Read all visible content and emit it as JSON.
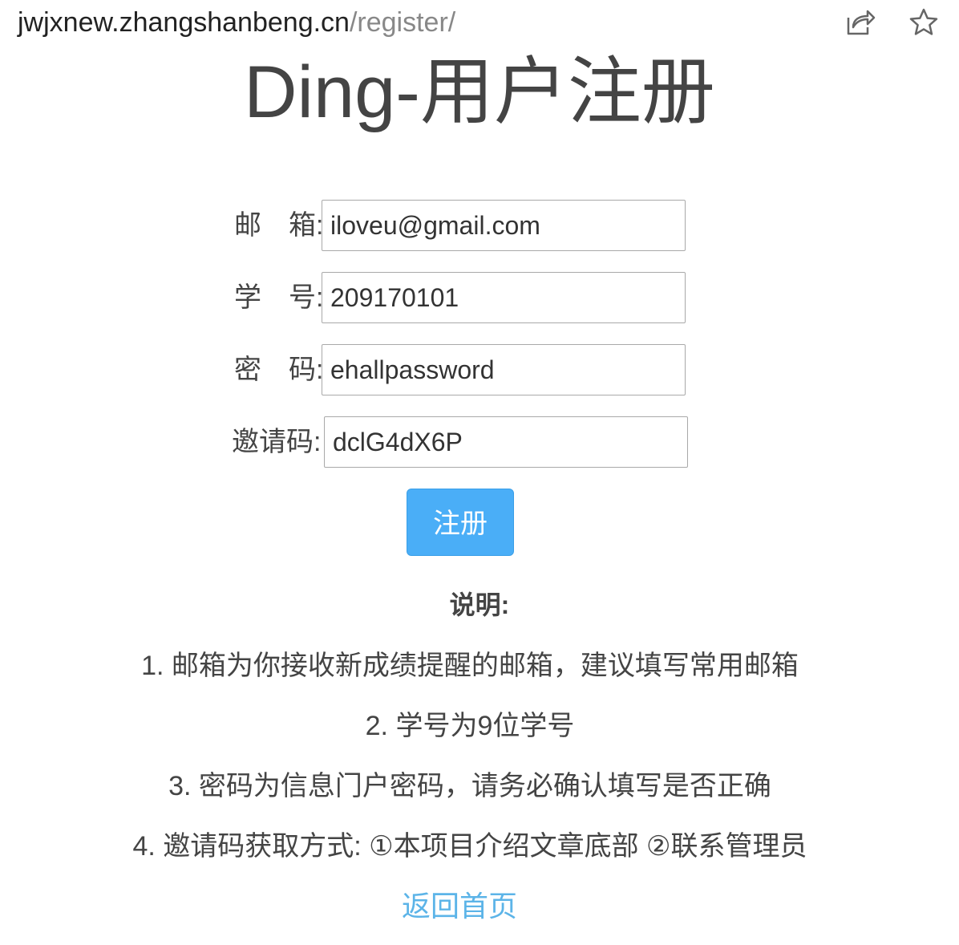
{
  "browser": {
    "url_host": "jwjxnew.zhangshanbeng.cn",
    "url_path": "/register/",
    "share_icon": "share-icon",
    "star_icon": "star-icon"
  },
  "page": {
    "title": "Ding-用户注册"
  },
  "form": {
    "email": {
      "label": "邮　箱:",
      "value": "iloveu@gmail.com"
    },
    "student_id": {
      "label": "学　号:",
      "value": "209170101"
    },
    "password": {
      "label": "密　码:",
      "value": "ehallpassword"
    },
    "invite_code": {
      "label": "邀请码:",
      "value": "dclG4dX6P"
    },
    "submit_label": "注册"
  },
  "instructions": {
    "title": "说明:",
    "items": [
      "1. 邮箱为你接收新成绩提醒的邮箱，建议填写常用邮箱",
      "2. 学号为9位学号",
      "3. 密码为信息门户密码，请务必确认填写是否正确",
      "4. 邀请码获取方式: ①本项目介绍文章底部 ②联系管理员"
    ]
  },
  "back_link": "返回首页",
  "colors": {
    "button_bg": "#4aaef7",
    "link": "#5cb4e8",
    "text": "#444444"
  }
}
